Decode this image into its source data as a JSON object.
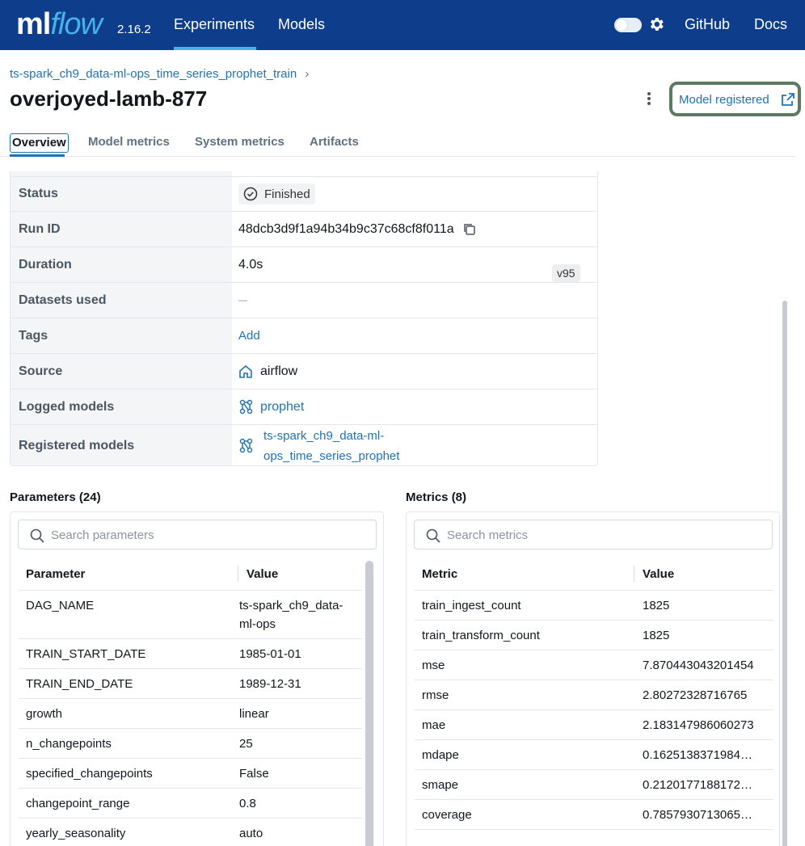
{
  "nav": {
    "logo_ml": "ml",
    "logo_flow": "flow",
    "version": "2.16.2",
    "experiments": "Experiments",
    "models": "Models",
    "github": "GitHub",
    "docs": "Docs",
    "theme_toggle_icon": "moon-toggle",
    "settings_icon": "gear-icon"
  },
  "header": {
    "breadcrumb": "ts-spark_ch9_data-ml-ops_time_series_prophet_train",
    "breadcrumb_sep": "›",
    "title": "overjoyed-lamb-877",
    "registered_button": "Model registered"
  },
  "tabs": [
    "Overview",
    "Model metrics",
    "System metrics",
    "Artifacts"
  ],
  "details": {
    "status_label": "Status",
    "status_value": "Finished",
    "run_id_label": "Run ID",
    "run_id_value": "48dcb3d9f1a94b34b9c37c68cf8f011a",
    "duration_label": "Duration",
    "duration_value": "4.0s",
    "datasets_label": "Datasets used",
    "datasets_value": "—",
    "tags_label": "Tags",
    "tags_value": "Add",
    "source_label": "Source",
    "source_value": "airflow",
    "logged_models_label": "Logged models",
    "logged_models_value": "prophet",
    "registered_models_label": "Registered models",
    "registered_models_line1": "ts-spark_ch9_data-ml-",
    "registered_models_line2": "ops_time_series_prophet",
    "registered_models_version": "v95"
  },
  "parameters": {
    "title": "Parameters (24)",
    "search_placeholder": "Search parameters",
    "col_param": "Parameter",
    "col_value": "Value",
    "rows": [
      {
        "k": "DAG_NAME",
        "v1": "ts-spark_ch9_data-",
        "v2": "ml-ops"
      },
      {
        "k": "TRAIN_START_DATE",
        "v1": "1985-01-01"
      },
      {
        "k": "TRAIN_END_DATE",
        "v1": "1989-12-31"
      },
      {
        "k": "growth",
        "v1": "linear"
      },
      {
        "k": "n_changepoints",
        "v1": "25"
      },
      {
        "k": "specified_changepoints",
        "v1": "False"
      },
      {
        "k": "changepoint_range",
        "v1": "0.8"
      },
      {
        "k": "yearly_seasonality",
        "v1": "auto"
      }
    ]
  },
  "metrics": {
    "title": "Metrics (8)",
    "search_placeholder": "Search metrics",
    "col_metric": "Metric",
    "col_value": "Value",
    "rows": [
      {
        "k": "train_ingest_count",
        "v": "1825"
      },
      {
        "k": "train_transform_count",
        "v": "1825"
      },
      {
        "k": "mse",
        "v": "7.870443043201454"
      },
      {
        "k": "rmse",
        "v": "2.80272328716765"
      },
      {
        "k": "mae",
        "v": "2.183147986060273"
      },
      {
        "k": "mdape",
        "v": "0.1625138371984…"
      },
      {
        "k": "smape",
        "v": "0.2120177188172…"
      },
      {
        "k": "coverage",
        "v": "0.7857930713065…"
      }
    ]
  },
  "colors": {
    "header_bg": "#0e3d8b",
    "accent": "#43b3ea",
    "link": "#2272b4"
  }
}
